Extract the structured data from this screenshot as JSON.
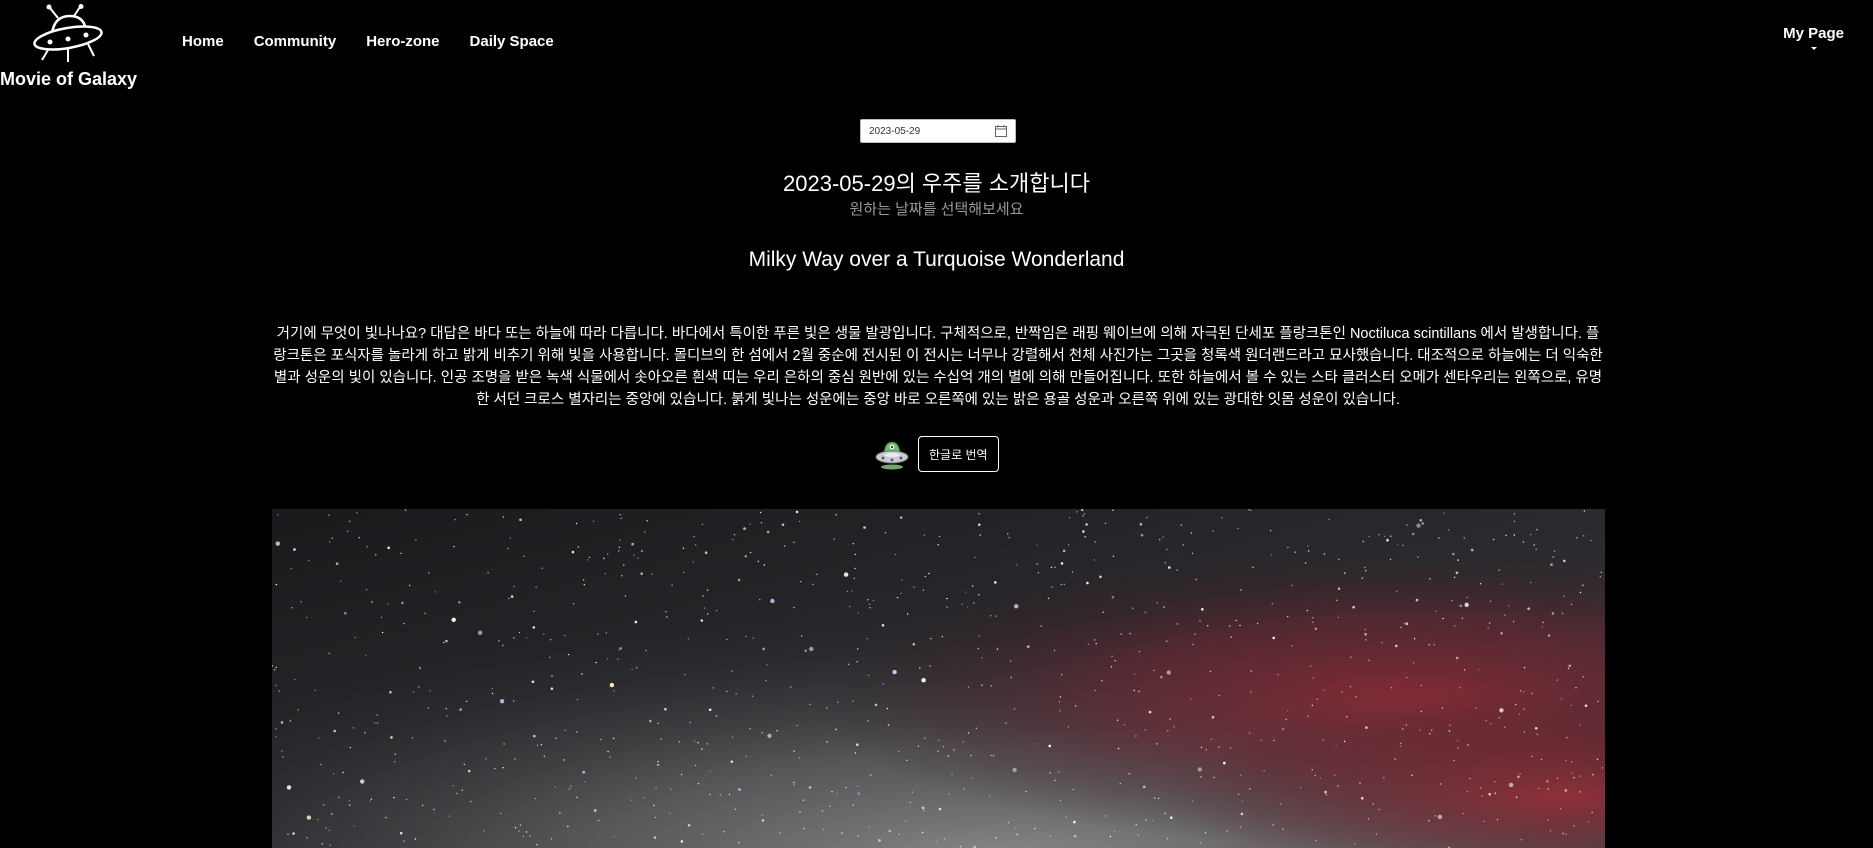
{
  "brand": {
    "name": "Movie of Galaxy",
    "logo_icon": "ufo-icon"
  },
  "nav": {
    "items": [
      {
        "label": "Home"
      },
      {
        "label": "Community"
      },
      {
        "label": "Hero-zone"
      },
      {
        "label": "Daily Space"
      }
    ],
    "mypage_label": "My Page"
  },
  "date_picker": {
    "value": "2023-05-29",
    "icon": "calendar-icon"
  },
  "intro": {
    "headline": "2023-05-29의 우주를 소개합니다",
    "subline": "원하는 날짜를 선택해보세요"
  },
  "apod": {
    "title": "Milky Way over a Turquoise Wonderland",
    "explanation": "거기에 무엇이 빛나나요? 대답은 바다 또는 하늘에 따라 다릅니다. 바다에서 특이한 푸른 빛은 생물 발광입니다. 구체적으로, 반짝임은 래핑 웨이브에 의해 자극된 단세포 플랑크톤인 Noctiluca scintillans 에서 발생합니다. 플랑크톤은 포식자를 놀라게 하고 밝게 비추기 위해 빛을 사용합니다. 몰디브의 한 섬에서 2월 중순에 전시된 이 전시는 너무나 강렬해서 천체 사진가는 그곳을 청록색 원더랜드라고 묘사했습니다. 대조적으로 하늘에는 더 익숙한 별과 성운의 빛이 있습니다. 인공 조명을 받은 녹색 식물에서 솟아오른 흰색 띠는 우리 은하의 중심 원반에 있는 수십억 개의 별에 의해 만들어집니다. 또한 하늘에서 볼 수 있는 스타 클러스터 오메가 센타우리는 왼쪽으로, 유명한 서던 크로스 별자리는 중앙에 있습니다. 붉게 빛나는 성운에는 중앙 바로 오른쪽에 있는 밝은 용골 성운과 오른쪽 위에 있는 광대한 잇몸 성운이 있습니다.",
    "translate_button": "한글로 번역",
    "mascot_icon": "ufo-mascot-icon",
    "image_icon": "milky-way-photo"
  },
  "colors": {
    "background": "#000000",
    "text": "#ffffff",
    "muted": "#9a9a9a",
    "nebula": "#8a2a35"
  }
}
